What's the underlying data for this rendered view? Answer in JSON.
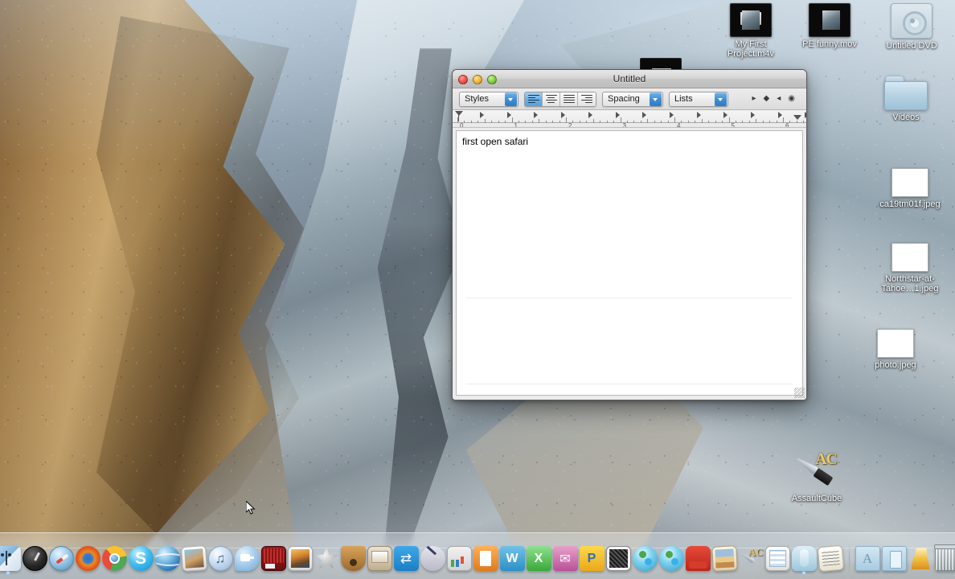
{
  "desktop": {
    "icons": [
      {
        "name": "my-first-project",
        "label": "My First Project.m4v",
        "type": "movie-file"
      },
      {
        "name": "pe-funny-mov",
        "label": "PE funny.mov",
        "type": "movie-file"
      },
      {
        "name": "untitled-dvd",
        "label": "Untitled DVD",
        "type": "dvd-volume"
      },
      {
        "name": "videos-folder",
        "label": "Videos",
        "type": "folder"
      },
      {
        "name": "ca19tm01f-jpeg",
        "label": "ca19tm01f.jpeg",
        "type": "image-file"
      },
      {
        "name": "northstar-at-tahoe-jpeg",
        "label": "Northstar-at-Tahoe…1.jpeg",
        "type": "image-file"
      },
      {
        "name": "photo-jpeg",
        "label": "photo.jpeg",
        "type": "image-file"
      },
      {
        "name": "assaultcube",
        "label": "AssaultCube",
        "type": "application"
      }
    ]
  },
  "window": {
    "title": "Untitled",
    "traffic_lights": {
      "close": {
        "name": "close-button",
        "color": "#f25b52"
      },
      "minimize": {
        "name": "minimize-button",
        "color": "#f6bd43"
      },
      "zoom": {
        "name": "zoom-button",
        "color": "#8ed44f"
      }
    },
    "toolbar": {
      "styles_label": "Styles",
      "spacing_label": "Spacing",
      "lists_label": "Lists",
      "alignment": [
        {
          "name": "align-left",
          "selected": true
        },
        {
          "name": "align-center",
          "selected": false
        },
        {
          "name": "align-justify",
          "selected": false
        },
        {
          "name": "align-right",
          "selected": false
        }
      ],
      "extra_controls": [
        "▸",
        "◆",
        "◂",
        "◉"
      ]
    },
    "ruler": {
      "unit": "inches",
      "ticks": [
        "0",
        "1",
        "2",
        "3",
        "4",
        "5",
        "6"
      ],
      "tab_stop_count": 13
    },
    "document": {
      "text": "first open safari"
    }
  },
  "dock": {
    "items": [
      {
        "name": "finder",
        "label": "Finder",
        "running": true,
        "class": "ic-finder"
      },
      {
        "name": "dashboard",
        "label": "Dashboard",
        "running": false,
        "class": "ic-dash"
      },
      {
        "name": "safari",
        "label": "Safari",
        "running": false,
        "class": "ic-safari"
      },
      {
        "name": "firefox",
        "label": "Firefox",
        "running": false,
        "class": "ic-firefox"
      },
      {
        "name": "google-chrome",
        "label": "Google Chrome",
        "running": false,
        "class": "ic-chrome"
      },
      {
        "name": "skype",
        "label": "Skype",
        "running": false,
        "class": "ic-skype"
      },
      {
        "name": "google-earth",
        "label": "Google Earth",
        "running": false,
        "class": "ic-earth"
      },
      {
        "name": "iphoto",
        "label": "iPhoto",
        "running": false,
        "class": "ic-iphoto"
      },
      {
        "name": "itunes",
        "label": "iTunes",
        "running": false,
        "class": "ic-itunes"
      },
      {
        "name": "facetime",
        "label": "FaceTime",
        "running": false,
        "class": "ic-facetime"
      },
      {
        "name": "idvd",
        "label": "iDVD",
        "running": false,
        "class": "ic-idvd"
      },
      {
        "name": "preview",
        "label": "Preview",
        "running": false,
        "class": "ic-preview"
      },
      {
        "name": "imovie",
        "label": "iMovie",
        "running": false,
        "class": "ic-imovie"
      },
      {
        "name": "garageband",
        "label": "GarageBand",
        "running": false,
        "class": "ic-garage"
      },
      {
        "name": "keynote",
        "label": "Keynote",
        "running": false,
        "class": "ic-keynote"
      },
      {
        "name": "teamviewer",
        "label": "TeamViewer",
        "running": false,
        "class": "ic-teamviewer"
      },
      {
        "name": "sketch-tool",
        "label": "Sketch",
        "running": false,
        "class": "ic-sketch"
      },
      {
        "name": "numbers",
        "label": "Numbers",
        "running": false,
        "class": "ic-numbers"
      },
      {
        "name": "pages",
        "label": "Pages",
        "running": false,
        "class": "ic-pages"
      },
      {
        "name": "microsoft-word",
        "label": "Microsoft Word",
        "running": false,
        "class": "ic-word"
      },
      {
        "name": "microsoft-excel",
        "label": "Microsoft Excel",
        "running": false,
        "class": "ic-excel"
      },
      {
        "name": "microsoft-entourage",
        "label": "Microsoft Entourage",
        "running": false,
        "class": "ic-entourage"
      },
      {
        "name": "microsoft-powerpoint",
        "label": "Microsoft PowerPoint",
        "running": false,
        "class": "ic-ppt"
      },
      {
        "name": "remote-desktop-connection",
        "label": "Remote Desktop Connection",
        "running": false,
        "class": "ic-rdc"
      },
      {
        "name": "messenger",
        "label": "Messenger",
        "running": false,
        "class": "ic-msn"
      },
      {
        "name": "messenger-2",
        "label": "Messenger",
        "running": false,
        "class": "ic-msn"
      },
      {
        "name": "front-row",
        "label": "Front Row",
        "running": false,
        "class": "ic-chair"
      },
      {
        "name": "scrapbook",
        "label": "Scrapbook",
        "running": false,
        "class": "ic-scrap"
      },
      {
        "name": "assaultcube",
        "label": "AssaultCube",
        "running": false,
        "class": "ic-ac"
      },
      {
        "name": "numbers-document",
        "label": "Numbers Document",
        "running": false,
        "class": "ic-numdoc"
      },
      {
        "name": "app-generic",
        "label": "Application",
        "running": true,
        "class": "ic-app"
      },
      {
        "name": "textedit-document",
        "label": "TextEdit Document",
        "running": false,
        "class": "ic-textedit"
      }
    ],
    "stack_items": [
      {
        "name": "applications-folder",
        "label": "Applications",
        "class": "ic-folder-app"
      },
      {
        "name": "documents-folder",
        "label": "Documents",
        "class": "ic-folder-doc"
      },
      {
        "name": "downloads-stack",
        "label": "Downloads",
        "class": "ic-downloads"
      },
      {
        "name": "trash",
        "label": "Trash",
        "class": "ic-trash"
      }
    ]
  }
}
